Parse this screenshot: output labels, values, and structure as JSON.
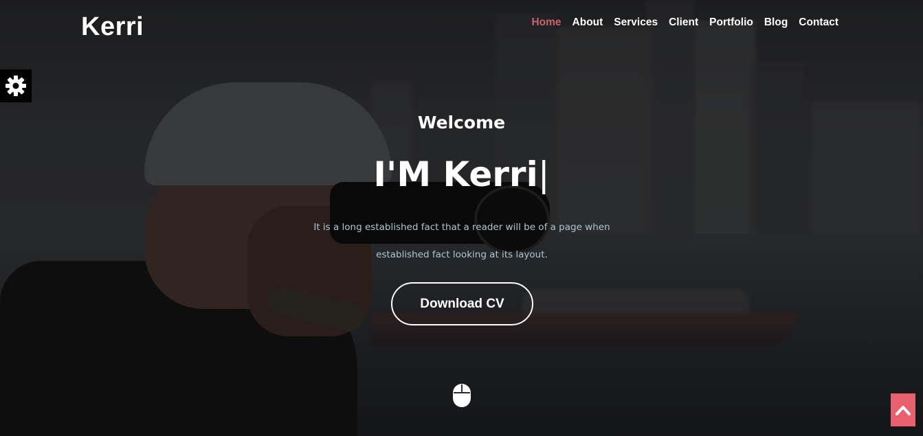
{
  "header": {
    "logo": "Kerri",
    "nav": [
      {
        "label": "Home",
        "active": true
      },
      {
        "label": "About",
        "active": false
      },
      {
        "label": "Services",
        "active": false
      },
      {
        "label": "Client",
        "active": false
      },
      {
        "label": "Portfolio",
        "active": false
      },
      {
        "label": "Blog",
        "active": false
      },
      {
        "label": "Contact",
        "active": false
      }
    ]
  },
  "hero": {
    "greeting": "Welcome",
    "headline": "I'M Kerri",
    "caret": "|",
    "description_line1": "It is a long established fact that a reader will be of a page when",
    "description_line2": "established fact looking at its layout.",
    "cta_label": "Download CV"
  },
  "icons": {
    "settings": "gear-icon",
    "scroll": "mouse-icon",
    "back_to_top": "chevron-up-icon"
  },
  "colors": {
    "accent": "#e8606e",
    "active_nav": "#c8636f",
    "description": "#aac7d3",
    "text": "#ffffff"
  }
}
